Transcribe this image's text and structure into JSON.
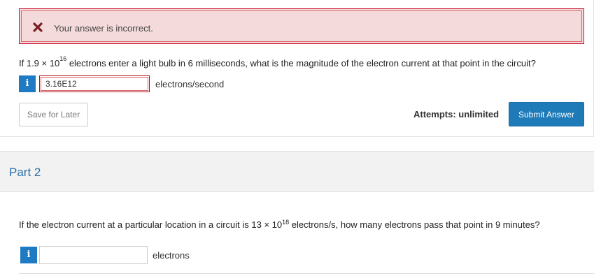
{
  "part1": {
    "alert": {
      "icon": "close-x-icon",
      "text": "Your answer is incorrect.",
      "border_color": "#c8102e",
      "background": "#f4dada"
    },
    "question": {
      "before_exp": "If 1.9 × 10",
      "exponent": "16",
      "after_exp": " electrons enter a light bulb in 6 milliseconds, what is the magnitude of the electron current at that point in the circuit?"
    },
    "info_icon": "i",
    "answer_value": "3.16E12",
    "unit": "electrons/second",
    "save_label": "Save for Later",
    "attempts": "Attempts: unlimited",
    "submit_label": "Submit Answer"
  },
  "part2": {
    "title": "Part 2",
    "question": {
      "before_exp": "If the electron current at a particular location in a circuit is 13 × 10",
      "exponent": "18",
      "after_exp": " electrons/s, how many electrons pass that point in 9 minutes?"
    },
    "info_icon": "i",
    "answer_value": "",
    "unit": "electrons"
  },
  "colors": {
    "accent": "#1f7ab8",
    "error": "#c8102e",
    "part_title": "#2a6fa8"
  }
}
